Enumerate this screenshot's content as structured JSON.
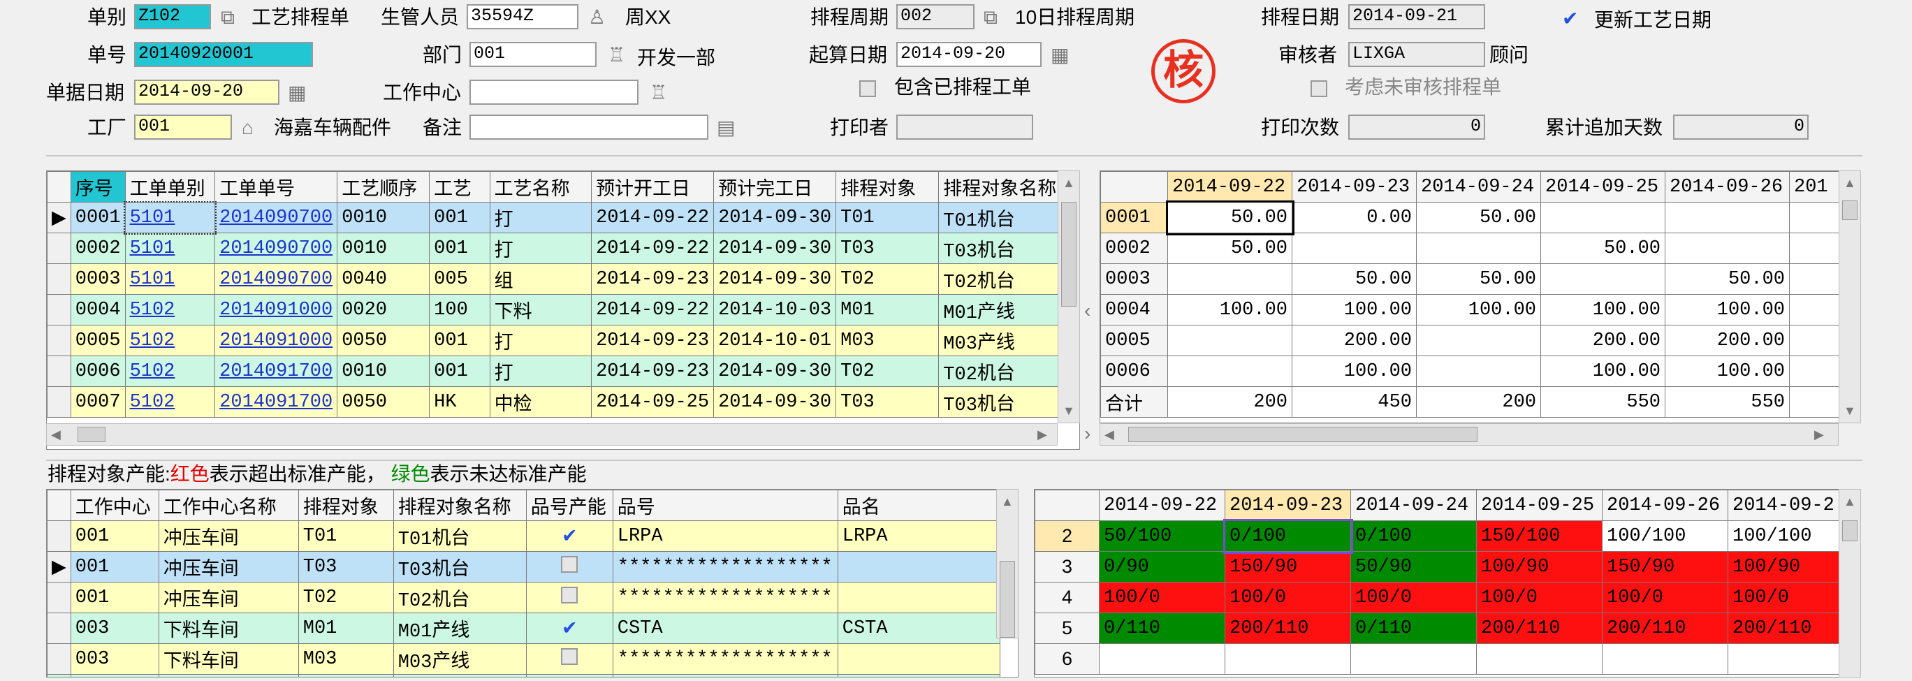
{
  "header": {
    "doc_type_label": "单别",
    "doc_type_value": "Z102",
    "doc_type_desc": "工艺排程单",
    "manager_label": "生管人员",
    "manager_value": "35594Z",
    "manager_name": "周XX",
    "cycle_label": "排程周期",
    "cycle_value": "002",
    "cycle_desc": "10日排程周期",
    "sched_date_label": "排程日期",
    "sched_date_value": "2014-09-21",
    "update_label": "更新工艺日期",
    "doc_no_label": "单号",
    "doc_no_value": "20140920001",
    "dept_label": "部门",
    "dept_value": "001",
    "dept_name": "开发一部",
    "start_date_label": "起算日期",
    "start_date_value": "2014-09-20",
    "reviewer_label": "审核者",
    "reviewer_value": "LIXGA",
    "reviewer_name": "顾问",
    "seal_char": "核",
    "bill_date_label": "单据日期",
    "bill_date_value": "2014-09-20",
    "wc_label": "工作中心",
    "wc_value": "",
    "include_label": "包含已排程工单",
    "consider_label": "考虑未审核排程单",
    "factory_label": "工厂",
    "factory_value": "001",
    "factory_name": "海嘉车辆配件",
    "remark_label": "备注",
    "remark_value": "",
    "printer_label": "打印者",
    "printer_value": "",
    "print_count_label": "打印次数",
    "print_count_value": "0",
    "extra_days_label": "累计追加天数",
    "extra_days_value": "0"
  },
  "orders": {
    "headers": [
      "序号",
      "工单单别",
      "工单单号",
      "工艺顺序",
      "工艺",
      "工艺名称",
      "预计开工日",
      "预计完工日",
      "排程对象",
      "排程对象名称"
    ],
    "rows": [
      [
        "0001",
        "5101",
        "2014090700",
        "0010",
        "001",
        "打",
        "2014-09-22",
        "2014-09-30",
        "T01",
        "T01机台"
      ],
      [
        "0002",
        "5101",
        "2014090700",
        "0010",
        "001",
        "打",
        "2014-09-22",
        "2014-09-30",
        "T03",
        "T03机台"
      ],
      [
        "0003",
        "5101",
        "2014090700",
        "0040",
        "005",
        "组",
        "2014-09-23",
        "2014-09-30",
        "T02",
        "T02机台"
      ],
      [
        "0004",
        "5102",
        "2014091000",
        "0020",
        "100",
        "下料",
        "2014-09-22",
        "2014-10-03",
        "M01",
        "M01产线"
      ],
      [
        "0005",
        "5102",
        "2014091000",
        "0050",
        "001",
        "打",
        "2014-09-23",
        "2014-10-01",
        "M03",
        "M03产线"
      ],
      [
        "0006",
        "5102",
        "2014091700",
        "0010",
        "001",
        "打",
        "2014-09-23",
        "2014-09-30",
        "T02",
        "T02机台"
      ],
      [
        "0007",
        "5102",
        "2014091700",
        "0050",
        "HK",
        "中检",
        "2014-09-25",
        "2014-09-30",
        "T03",
        "T03机台"
      ]
    ]
  },
  "qty": {
    "dates": [
      "2014-09-22",
      "2014-09-23",
      "2014-09-24",
      "2014-09-25",
      "2014-09-26",
      "201"
    ],
    "rows": [
      {
        "id": "0001",
        "vals": [
          "50.00",
          "0.00",
          "50.00",
          "",
          "",
          ""
        ]
      },
      {
        "id": "0002",
        "vals": [
          "50.00",
          "",
          "",
          "50.00",
          "",
          ""
        ]
      },
      {
        "id": "0003",
        "vals": [
          "",
          "50.00",
          "50.00",
          "",
          "50.00",
          ""
        ]
      },
      {
        "id": "0004",
        "vals": [
          "100.00",
          "100.00",
          "100.00",
          "100.00",
          "100.00",
          ""
        ]
      },
      {
        "id": "0005",
        "vals": [
          "",
          "200.00",
          "",
          "200.00",
          "200.00",
          ""
        ]
      },
      {
        "id": "0006",
        "vals": [
          "",
          "100.00",
          "",
          "100.00",
          "100.00",
          ""
        ]
      }
    ],
    "total_label": "合计",
    "totals": [
      "200",
      "450",
      "200",
      "550",
      "550",
      ""
    ]
  },
  "capacity_note": {
    "prefix": "排程对象产能:",
    "red": "红色",
    "mid": "表示超出标准产能，",
    "green": "绿色",
    "suffix": "表示未达标准产能"
  },
  "capacity": {
    "headers": [
      "工作中心",
      "工作中心名称",
      "排程对象",
      "排程对象名称",
      "品号产能",
      "品号",
      "品名"
    ],
    "rows": [
      [
        "001",
        "冲压车间",
        "T01",
        "T01机台",
        true,
        "LRPA",
        "LRPA"
      ],
      [
        "001",
        "冲压车间",
        "T03",
        "T03机台",
        false,
        "*******************",
        ""
      ],
      [
        "001",
        "冲压车间",
        "T02",
        "T02机台",
        false,
        "*******************",
        ""
      ],
      [
        "003",
        "下料车间",
        "M01",
        "M01产线",
        true,
        "CSTA",
        "CSTA"
      ],
      [
        "003",
        "下料车间",
        "M03",
        "M03产线",
        false,
        "*******************",
        ""
      ]
    ]
  },
  "load": {
    "dates": [
      "2014-09-22",
      "2014-09-23",
      "2014-09-24",
      "2014-09-25",
      "2014-09-26",
      "2014-09-2"
    ],
    "rows": [
      {
        "id": "2",
        "cells": [
          [
            "50/100",
            "g"
          ],
          [
            "0/100",
            "g"
          ],
          [
            "0/100",
            "g"
          ],
          [
            "150/100",
            "r"
          ],
          [
            "100/100",
            "w"
          ],
          [
            "100/100",
            "w"
          ]
        ]
      },
      {
        "id": "3",
        "cells": [
          [
            "0/90",
            "g"
          ],
          [
            "150/90",
            "r"
          ],
          [
            "50/90",
            "g"
          ],
          [
            "100/90",
            "r"
          ],
          [
            "150/90",
            "r"
          ],
          [
            "100/90",
            "r"
          ]
        ]
      },
      {
        "id": "4",
        "cells": [
          [
            "100/0",
            "r"
          ],
          [
            "100/0",
            "r"
          ],
          [
            "100/0",
            "r"
          ],
          [
            "100/0",
            "r"
          ],
          [
            "100/0",
            "r"
          ],
          [
            "100/0",
            "r"
          ]
        ]
      },
      {
        "id": "5",
        "cells": [
          [
            "0/110",
            "g"
          ],
          [
            "200/110",
            "r"
          ],
          [
            "0/110",
            "g"
          ],
          [
            "200/110",
            "r"
          ],
          [
            "200/110",
            "r"
          ],
          [
            "200/110",
            "r"
          ]
        ]
      },
      {
        "id": "6",
        "cells": [
          [
            "",
            "w"
          ],
          [
            "",
            "w"
          ],
          [
            "",
            "w"
          ],
          [
            "",
            "w"
          ],
          [
            "",
            "w"
          ],
          [
            "",
            "w"
          ]
        ]
      }
    ]
  },
  "colors": {
    "cyan": "#22c6d2",
    "yellow": "#ffffc0",
    "green": "#008a00",
    "red": "#ff1010",
    "selected_row": "#bfe1f7",
    "alt_row": "#ccf7e2",
    "header_highlight": "#ffe9b0"
  }
}
